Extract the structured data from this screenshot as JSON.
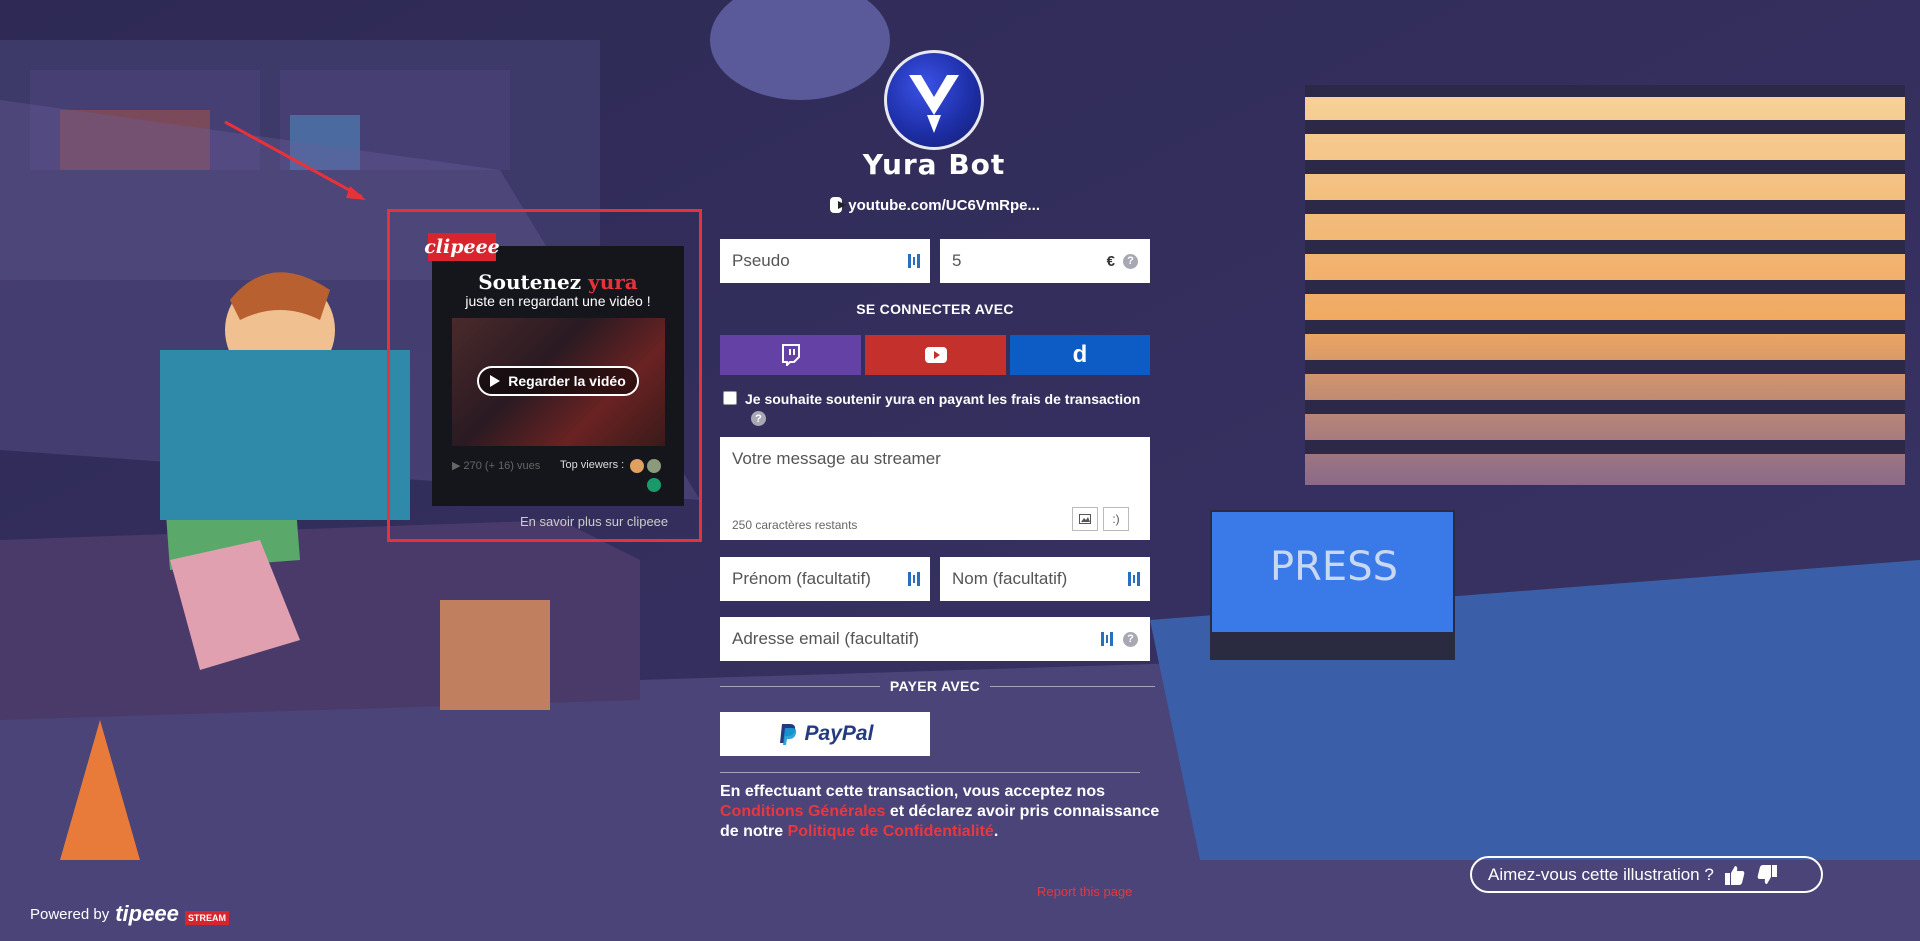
{
  "streamer": {
    "name": "Yura Bot",
    "channel": "youtube.com/UC6VmRpe..."
  },
  "form": {
    "pseudo_placeholder": "Pseudo",
    "amount_value": "5",
    "currency": "€",
    "help": "?",
    "connect_label": "SE CONNECTER AVEC",
    "social": [
      {
        "name": "twitch",
        "color": "#6441a5"
      },
      {
        "name": "youtube",
        "color": "#c4302b"
      },
      {
        "name": "dailymotion",
        "color": "#0d5cc6",
        "glyph": "d"
      }
    ],
    "fee_checkbox_label": "Je souhaite soutenir yura en payant les frais de transaction",
    "message_placeholder": "Votre message au streamer",
    "message_counter": "250 caractères restants",
    "smiley": ":)",
    "firstname_placeholder": "Prénom (facultatif)",
    "lastname_placeholder": "Nom (facultatif)",
    "email_placeholder": "Adresse email (facultatif)",
    "pay_label": "PAYER AVEC",
    "paypal_label": "PayPal"
  },
  "legal": {
    "part1": "En effectuant cette transaction, vous acceptez nos",
    "link1": "Conditions Générales",
    "part2": "et déclarez avoir pris connaissance de notre",
    "link2": "Politique de Confidentialité",
    "part3": "."
  },
  "report_link": "Report this page",
  "clip_widget": {
    "badge": "clipeee",
    "title_main": "Soutenez",
    "title_accent": "yura",
    "subtitle": "juste en regardant une vidéo !",
    "watch_button": "Regarder la vidéo",
    "views": "270 (+ 16) vues",
    "top_viewers": "Top viewers :",
    "learn_more": "En savoir plus sur clipeee"
  },
  "footer": {
    "powered_by": "Powered by",
    "brand": "tipeee",
    "brand_tag": "STREAM",
    "illustration_question": "Aimez-vous cette illustration ?"
  },
  "colors": {
    "accent_red": "#e8373e",
    "twitch": "#6441a5",
    "youtube": "#c4302b",
    "dailymotion": "#0d5cc6"
  }
}
